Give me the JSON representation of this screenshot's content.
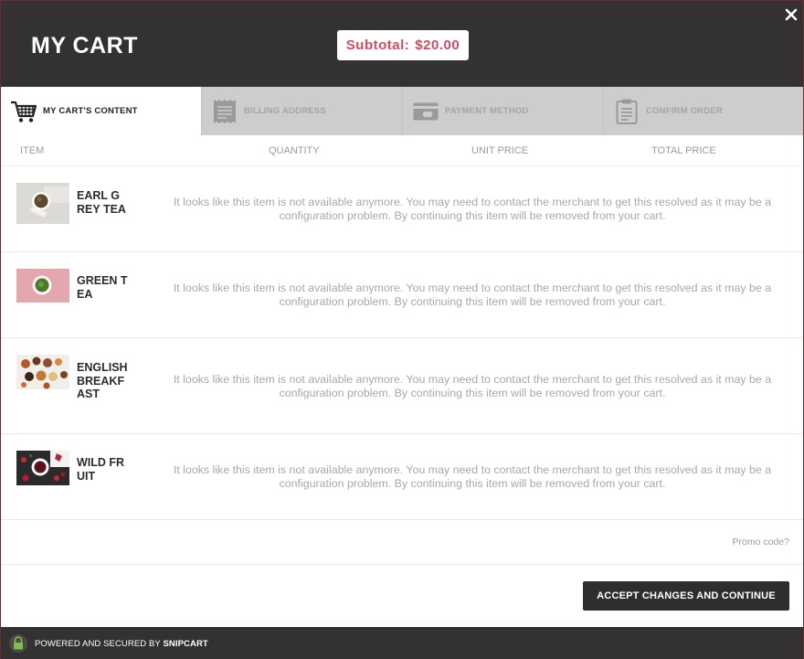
{
  "header": {
    "title": "MY CART",
    "subtotal_label": "Subtotal:",
    "subtotal_value": "$20.00",
    "accent_color": "#d8485e"
  },
  "steps": [
    {
      "label": "MY CART'S CONTENT",
      "icon": "cart-icon",
      "active": true
    },
    {
      "label": "BILLING ADDRESS",
      "icon": "receipt-icon",
      "active": false
    },
    {
      "label": "PAYMENT METHOD",
      "icon": "credit-card-icon",
      "active": false
    },
    {
      "label": "CONFIRM ORDER",
      "icon": "clipboard-icon",
      "active": false
    }
  ],
  "table": {
    "columns": [
      "ITEM",
      "QUANTITY",
      "UNIT PRICE",
      "TOTAL PRICE"
    ],
    "unavailable_message": "It looks like this item is not available anymore. You may need to contact the merchant to get this resolved as it may be a configuration problem. By continuing this item will be removed from your cart.",
    "items": [
      {
        "name": "EARL GREY TEA"
      },
      {
        "name": "GREEN TEA"
      },
      {
        "name": "ENGLISH BREAKFAST"
      },
      {
        "name": "WILD FRUIT"
      }
    ]
  },
  "promo": {
    "label": "Promo code?"
  },
  "actions": {
    "accept_label": "ACCEPT CHANGES AND CONTINUE"
  },
  "footer": {
    "text": "POWERED AND SECURED BY",
    "brand": "SNIPCART"
  }
}
